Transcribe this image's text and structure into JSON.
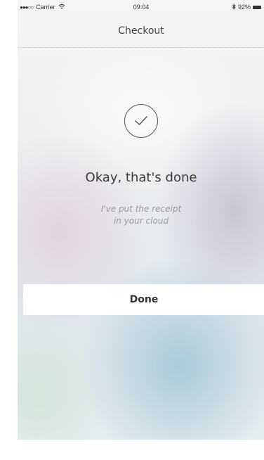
{
  "status_bar": {
    "signal": "●●●○○",
    "carrier": "Carrier",
    "wifi_icon": "wifi-icon",
    "time": "09:04",
    "bluetooth_icon": "bluetooth-icon",
    "battery": "92%"
  },
  "nav": {
    "title": "Checkout"
  },
  "confirmation": {
    "icon": "checkmark-circle-icon",
    "headline": "Okay, that's done",
    "subtext_line1": "I've put the receipt",
    "subtext_line2": "in your cloud"
  },
  "actions": {
    "done_label": "Done"
  }
}
